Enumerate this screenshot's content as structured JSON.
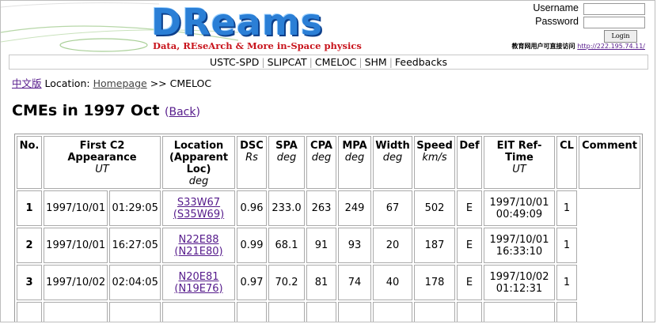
{
  "header": {
    "logo_word": "DReams",
    "logo_subtitle": "Data, REseArch & More in-Space physics"
  },
  "login": {
    "username_label": "Username",
    "password_label": "Password",
    "button_label": "Login",
    "notice_text": "教育网用户可直接访问",
    "notice_link": "http://222.195.74.11/"
  },
  "nav": {
    "items": [
      "USTC-SPD",
      "SLIPCAT",
      "CMELOC",
      "SHM",
      "Feedbacks"
    ]
  },
  "breadcrumb": {
    "lang_link": "中文版",
    "location_label": "Location:",
    "home_link": "Homepage",
    "current": ">> CMELOC"
  },
  "page": {
    "title": "CMEs in 1997 Oct",
    "back_link": "Back"
  },
  "table": {
    "headers": {
      "no": "No.",
      "first_c2": "First C2 Appearance",
      "first_c2_unit": "UT",
      "location": "Location (Apparent Loc)",
      "location_unit": "deg",
      "dsc": "DSC",
      "dsc_unit": "Rs",
      "spa": "SPA",
      "spa_unit": "deg",
      "cpa": "CPA",
      "cpa_unit": "deg",
      "mpa": "MPA",
      "mpa_unit": "deg",
      "width": "Width",
      "width_unit": "deg",
      "speed": "Speed",
      "speed_unit": "km/s",
      "def": "Def",
      "eit": "EIT Ref-Time",
      "eit_unit": "UT",
      "cl": "CL",
      "comment": "Comment"
    },
    "rows": [
      {
        "no": "1",
        "date": "1997/10/01",
        "time": "01:29:05",
        "loc": "S33W67",
        "apparent": "(S35W69)",
        "dsc": "0.96",
        "spa": "233.0",
        "cpa": "263",
        "mpa": "249",
        "width": "67",
        "speed": "502",
        "def": "E",
        "eit_date": "1997/10/01",
        "eit_time": "00:49:09",
        "cl": "1"
      },
      {
        "no": "2",
        "date": "1997/10/01",
        "time": "16:27:05",
        "loc": "N22E88",
        "apparent": "(N21E80)",
        "dsc": "0.99",
        "spa": "68.1",
        "cpa": "91",
        "mpa": "93",
        "width": "20",
        "speed": "187",
        "def": "E",
        "eit_date": "1997/10/01",
        "eit_time": "16:33:10",
        "cl": "1"
      },
      {
        "no": "3",
        "date": "1997/10/02",
        "time": "02:04:05",
        "loc": "N20E81",
        "apparent": "(N19E76)",
        "dsc": "0.97",
        "spa": "70.2",
        "cpa": "81",
        "mpa": "74",
        "width": "40",
        "speed": "178",
        "def": "E",
        "eit_date": "1997/10/02",
        "eit_time": "01:12:31",
        "cl": "1"
      }
    ]
  }
}
